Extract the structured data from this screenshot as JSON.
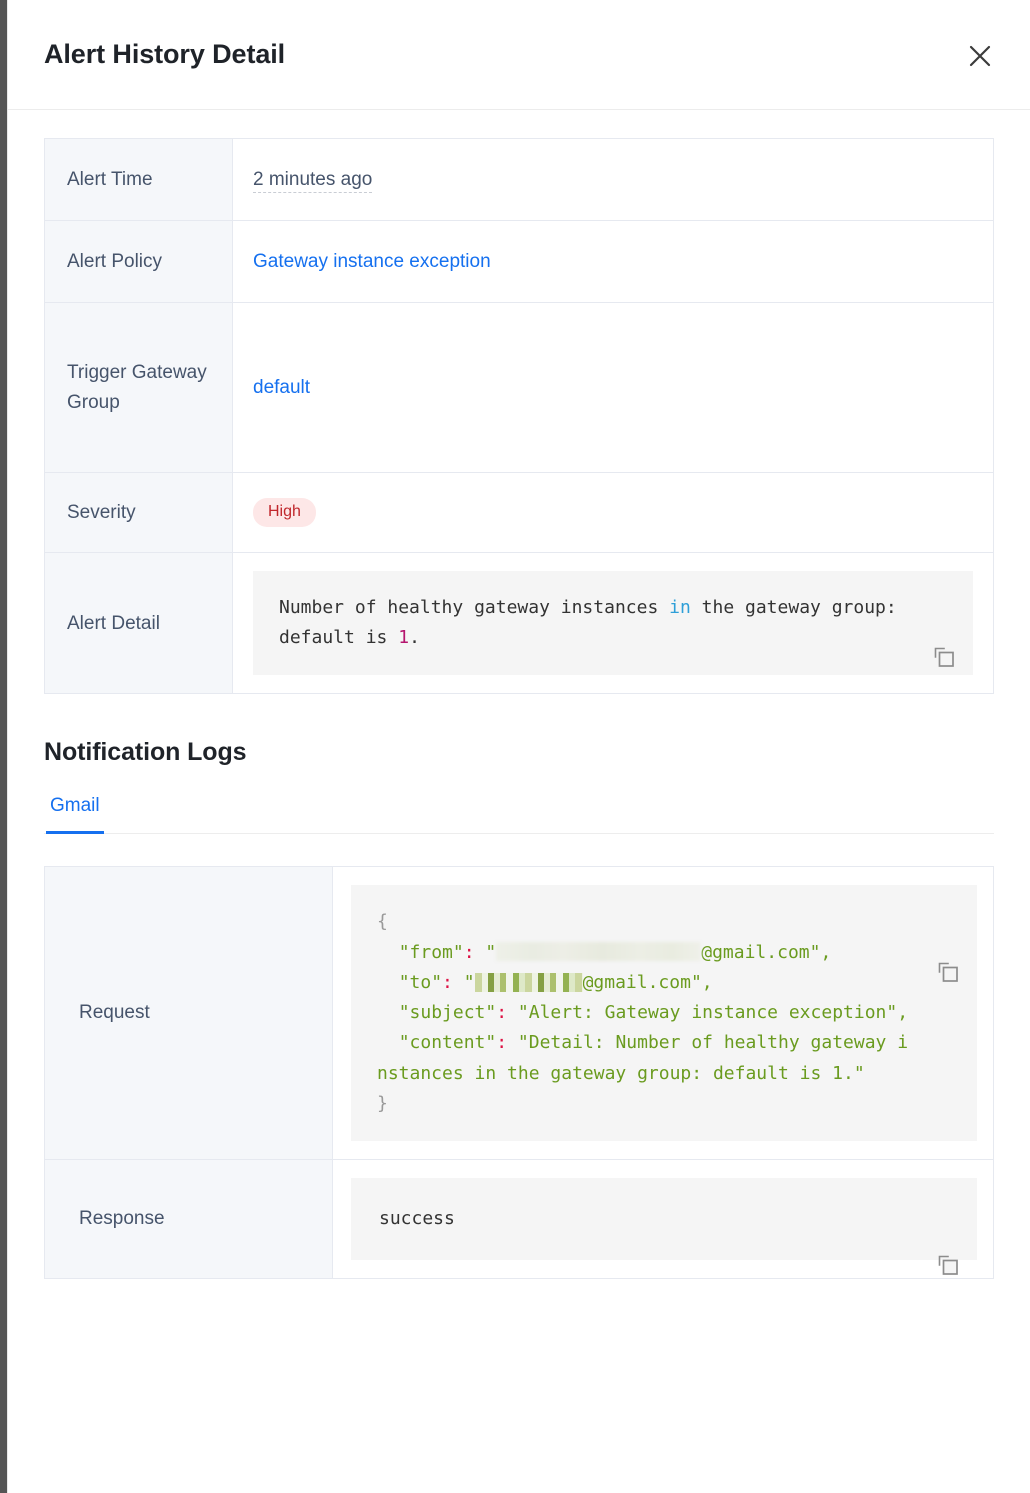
{
  "header": {
    "title": "Alert History Detail",
    "close_label": "Close",
    "close_icon": "close-icon"
  },
  "detail": {
    "rows": [
      {
        "label": "Alert Time",
        "value": "2 minutes ago"
      },
      {
        "label": "Alert Policy",
        "value": "Gateway instance exception"
      },
      {
        "label": "Trigger Gateway Group",
        "value": "default"
      },
      {
        "label": "Severity",
        "value": "High"
      },
      {
        "label": "Alert Detail",
        "value": "Number of healthy gateway instances in the gateway group: default is 1."
      }
    ],
    "alert_time": "2 minutes ago",
    "alert_policy_label": "Alert Policy",
    "alert_policy": "Gateway instance exception",
    "trigger_group_label": "Trigger Gateway Group",
    "trigger_group": "default",
    "severity_label": "Severity",
    "severity": "High",
    "severity_color": "#c0262b",
    "severity_bg": "#fde7e7",
    "alert_detail_label": "Alert Detail",
    "alert_detail_tokens": {
      "seg1": "Number of healthy gateway instances ",
      "kw_in": "in",
      "seg2": " the gateway group: default is ",
      "num": "1",
      "seg3": "."
    },
    "copy_icon": "copy-icon"
  },
  "notification_logs": {
    "section_title": "Notification Logs",
    "tabs": [
      {
        "label": "Gmail",
        "active": true
      }
    ],
    "active_tab_color": "#1570ef",
    "rows": [
      {
        "label": "Request"
      },
      {
        "label": "Response"
      }
    ],
    "request_label": "Request",
    "response_label": "Response",
    "response_value": "success",
    "request_json": {
      "open_brace": "{",
      "close_brace": "}",
      "from_key": "\"from\"",
      "from_suffix": "@gmail.com\",",
      "from_redacted": true,
      "to_key": "\"to\"",
      "to_suffix": "@gmail.com\",",
      "to_redacted": true,
      "subject_key": "\"subject\"",
      "subject_value": "\"Alert: Gateway instance exception\",",
      "content_key": "\"content\"",
      "content_value": "\"Detail: Number of healthy gateway instances in the gateway group: default is 1.\"",
      "quote": "\"",
      "colon": ":"
    },
    "copy_icon": "copy-icon"
  },
  "colors": {
    "link": "#1570ef",
    "label_bg": "#f5f7fa",
    "code_bg": "#f5f5f5",
    "border": "#e6e9f0",
    "string": "#6a9b1f",
    "keyword": "#2e9fd8",
    "number": "#b5156e"
  }
}
